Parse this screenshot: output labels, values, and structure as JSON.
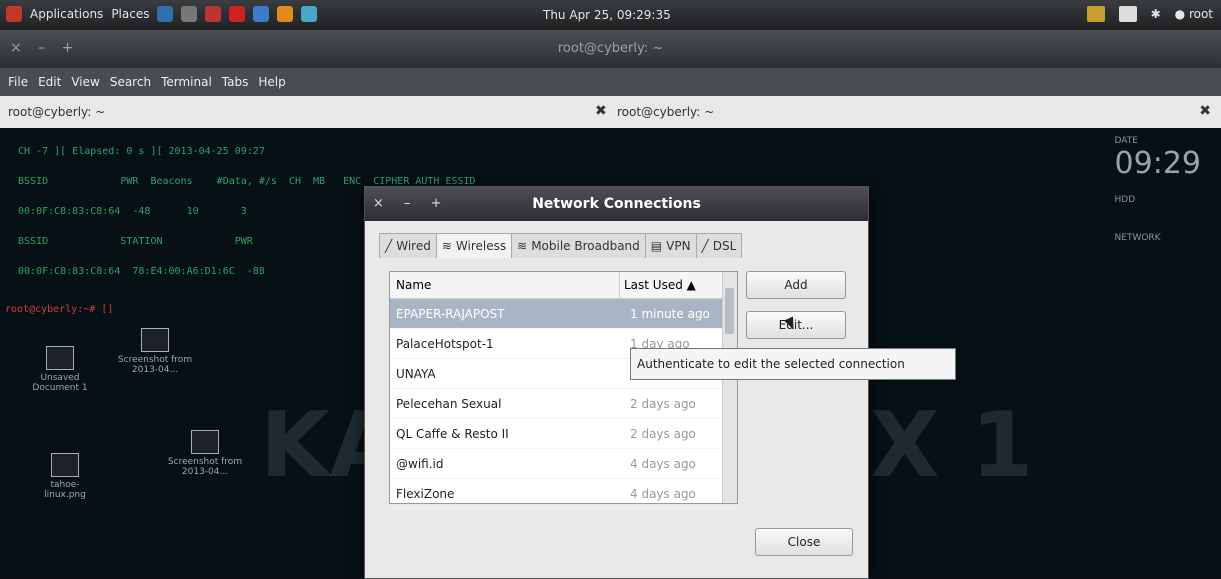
{
  "panel": {
    "applications": "Applications",
    "places": "Places",
    "clock": "Thu Apr 25, 09:29:35",
    "user": "root"
  },
  "window": {
    "title": "root@cyberly: ~",
    "menu": [
      "File",
      "Edit",
      "View",
      "Search",
      "Terminal",
      "Tabs",
      "Help"
    ],
    "tabs": [
      "root@cyberly: ~",
      "root@cyberly: ~"
    ]
  },
  "terminal": {
    "lines": [
      "CH -7 ][ Elapsed: 0 s ][ 2013-04-25 09:27",
      "BSSID            PWR  Beacons    #Data, #/s  CH  MB   ENC  CIPHER AUTH ESSID",
      "00:0F:C8:83:C8:64  -48      10       3",
      "BSSID            STATION            PWR",
      "00:0F:C8:83:C8:64  78:E4:00:A6:D1:6C  -88",
      "root@cyberly:~# []"
    ]
  },
  "conky": {
    "date_label": "DATE",
    "time": "09:29",
    "hdd_label": "HDD",
    "network_label": "NETWORK"
  },
  "desktop": {
    "icons": [
      "Screenshot from 2013-04...",
      "Unsaved Document 1",
      "Screenshot from 2013-04...",
      "tahoe-linux.png"
    ]
  },
  "dialog": {
    "title": "Network Connections",
    "tabs": [
      "Wired",
      "Wireless",
      "Mobile Broadband",
      "VPN",
      "DSL"
    ],
    "active_tab": "Wireless",
    "columns": {
      "name": "Name",
      "last_used": "Last Used ▲"
    },
    "connections": [
      {
        "name": "EPAPER-RAJAPOST",
        "last_used": "1 minute ago"
      },
      {
        "name": "PalaceHotspot-1",
        "last_used": "1 day ago"
      },
      {
        "name": "UNAYA",
        "last_used": "1"
      },
      {
        "name": "Pelecehan Sexual",
        "last_used": "2 days ago"
      },
      {
        "name": "QL Caffe & Resto II",
        "last_used": "2 days ago"
      },
      {
        "name": "@wifi.id",
        "last_used": "4 days ago"
      },
      {
        "name": "FlexiZone",
        "last_used": "4 days ago"
      }
    ],
    "buttons": {
      "add": "Add",
      "edit": "Edit...",
      "close": "Close"
    },
    "tooltip": "Authenticate to edit the selected connection"
  },
  "colors": {
    "selected_row": "#a9b4c4",
    "terminal_text": "#2fa06a",
    "terminal_bg": "#071014"
  }
}
